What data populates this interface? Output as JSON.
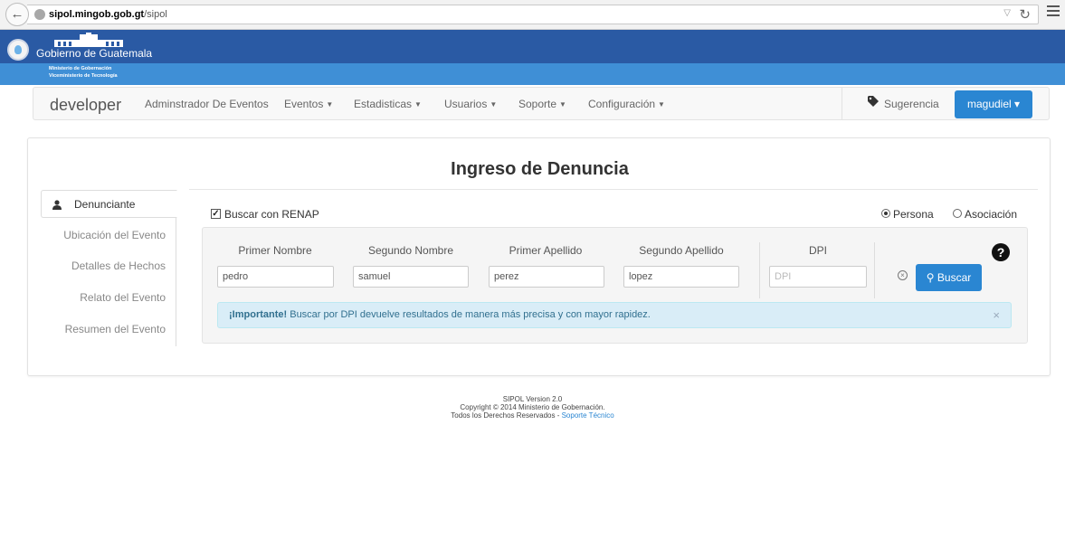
{
  "browser": {
    "url_host": "sipol.mingob.gob.gt",
    "url_path": "/sipol"
  },
  "banner": {
    "gov_name": "Gobierno de Guatemala",
    "ministry": "Ministerio de Gobernación",
    "vice_ministry": "Viceministerio de Tecnología",
    "primary_color": "#2a5aa4",
    "strip_color": "#3f8fd6"
  },
  "navbar": {
    "brand": "developer",
    "items": [
      {
        "label": "Adminstrador De Eventos",
        "caret": ""
      },
      {
        "label": "Eventos",
        "caret": "▼"
      },
      {
        "label": "Estadisticas",
        "caret": "▼"
      },
      {
        "label": "Usuarios",
        "caret": "▼"
      },
      {
        "label": "Soporte",
        "caret": "▼"
      },
      {
        "label": "Configuración",
        "caret": "▼"
      }
    ],
    "suggestion": "Sugerencia",
    "user": "magudiel ▾",
    "accent": "#2a86d2"
  },
  "page": {
    "title": "Ingreso de Denuncia"
  },
  "sidebar": {
    "items": [
      {
        "label": "Denunciante",
        "active": true
      },
      {
        "label": "Ubicación del Evento",
        "active": false
      },
      {
        "label": "Detalles de Hechos",
        "active": false
      },
      {
        "label": "Relato del Evento",
        "active": false
      },
      {
        "label": "Resumen del Evento",
        "active": false
      }
    ]
  },
  "form": {
    "renap_label": "Buscar con RENAP",
    "renap_checked": true,
    "check_mark": "✓",
    "radio_options": [
      {
        "label": "Persona",
        "selected": true
      },
      {
        "label": "Asociación",
        "selected": false
      }
    ],
    "columns": {
      "first_name": "Primer Nombre",
      "second_name": "Segundo Nombre",
      "first_surname": "Primer Apellido",
      "second_surname": "Segundo Apellido",
      "dpi": "DPI"
    },
    "values": {
      "first_name": "pedro",
      "second_name": "samuel",
      "first_surname": "perez",
      "second_surname": "lopez",
      "dpi": ""
    },
    "dpi_placeholder": "DPI",
    "search_button": "Buscar",
    "search_glyph": "🔍",
    "clear_glyph": "×",
    "help_glyph": "?",
    "alert_strong": "¡Importante!",
    "alert_text": " Buscar por DPI devuelve resultados de manera más precisa y con mayor rapidez.",
    "alert_close": "×"
  },
  "footer": {
    "version": "SIPOL Version 2.0",
    "copyright": "Copyright © 2014 Ministerio de Gobernación.",
    "rights": "Todos los Derechos Reservados - ",
    "support_link": "Soporte Técnico"
  }
}
